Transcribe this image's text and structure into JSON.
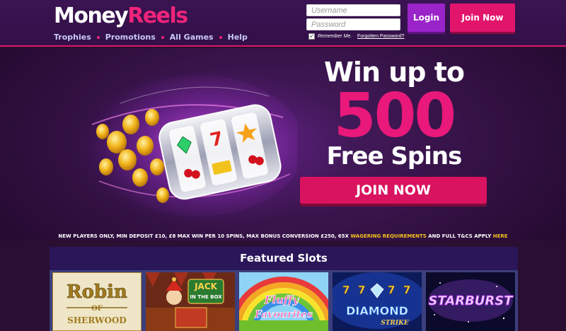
{
  "header": {
    "logo": {
      "part1": "Money",
      "part2": "Reels"
    },
    "nav": [
      "Trophies",
      "Promotions",
      "All Games",
      "Help"
    ],
    "login_form": {
      "username_placeholder": "Username",
      "password_placeholder": "Password",
      "remember_label": "Remember Me.",
      "remember_checked": true,
      "forgot_link": "Forgotten Password?"
    },
    "login_button": "Login",
    "join_button": "Join Now"
  },
  "hero": {
    "line1": "Win up to",
    "number": "500",
    "line3": "Free Spins",
    "join_button": "JOIN NOW"
  },
  "terms": {
    "text_before": "NEW PLAYERS ONLY, MIN DEPOSIT £10, £8 MAX WIN PER 10 SPINS, MAX BONUS CONVERSION £250, 65X",
    "link_wagering": "WAGERING REQUIREMENTS",
    "text_middle": "AND FULL T&CS APPLY",
    "link_here": "HERE"
  },
  "featured": {
    "title": "Featured Slots",
    "slots": [
      {
        "name": "Robin of Sherwood",
        "lines": [
          "Robin",
          "OF",
          "SHERWOOD"
        ]
      },
      {
        "name": "Jack in the Box",
        "lines": [
          "JACK",
          "IN THE BOX"
        ]
      },
      {
        "name": "Fluffy Favourites",
        "lines": [
          "Fluffy",
          "Favourites"
        ]
      },
      {
        "name": "Diamond Strike",
        "lines": [
          "7",
          "7",
          "7",
          "7",
          "DIAMOND",
          "STRIKE"
        ]
      },
      {
        "name": "Starburst",
        "lines": [
          "STARBURST"
        ]
      }
    ]
  },
  "colors": {
    "brand_pink": "#e2156c",
    "login_purple": "#9a23c9",
    "nav_text": "#c8c9f5",
    "terms_highlight": "#f5c21d",
    "header_bg": "#3a1452",
    "featured_bg": "#2b1659"
  }
}
